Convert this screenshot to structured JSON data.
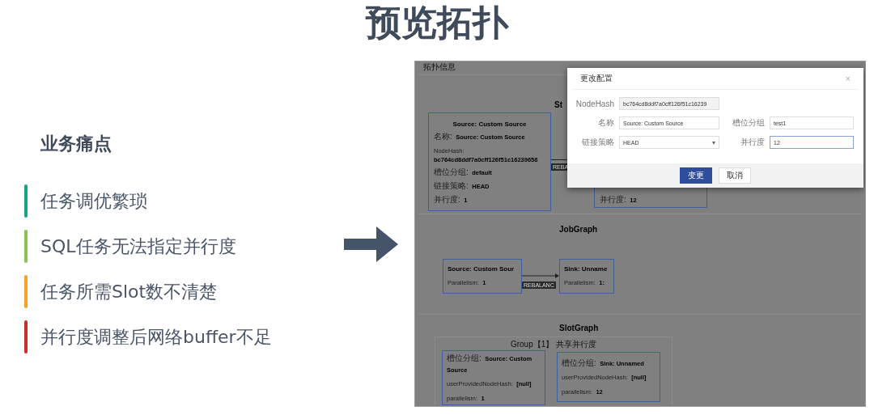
{
  "title": "预览拓扑",
  "pain_points": {
    "heading": "业务痛点",
    "items": [
      {
        "text": "任务调优繁琐",
        "color": "#1aa386"
      },
      {
        "text": "SQL任务无法指定并行度",
        "color": "#8bc157"
      },
      {
        "text": "任务所需Slot数不清楚",
        "color": "#f5a12a"
      },
      {
        "text": "并行度调整后网络buffer不足",
        "color": "#c9302c"
      }
    ]
  },
  "screenshot": {
    "header": "拓扑信息",
    "stream_graph": {
      "title": "St",
      "edge_label": "REBA",
      "source_node": {
        "title": "Source: Custom Source",
        "fields": [
          {
            "label": "名称:",
            "value": "Source: Custom Source",
            "kind": "inline"
          },
          {
            "label": "NodeHash:",
            "value": "bc764cd8ddf7a0cff126f51c16239658",
            "kind": "stacked"
          },
          {
            "label": "槽位分组:",
            "value": "default",
            "kind": "inline"
          },
          {
            "label": "链接策略:",
            "value": "HEAD",
            "kind": "inline"
          },
          {
            "label": "并行度:",
            "value": "1",
            "kind": "inline"
          }
        ]
      },
      "sink_node": {
        "fields": [
          {
            "label": "并行度:",
            "value": "12",
            "kind": "inline"
          }
        ]
      }
    },
    "job_graph": {
      "title": "JobGraph",
      "edge_label": "REBALANC",
      "nodes": [
        {
          "name": "Source: Custom Sour",
          "fields": [
            {
              "label": "Parallelism:",
              "value": "1",
              "kind": "inline"
            }
          ]
        },
        {
          "name": "Sink: Unname",
          "fields": [
            {
              "label": "Parallelism:",
              "value": "1:",
              "kind": "inline"
            }
          ]
        }
      ]
    },
    "slot_graph": {
      "title": "SlotGraph",
      "group": "Group【1】 共享并行度",
      "nodes": [
        {
          "fields": [
            {
              "label": "槽位分组:",
              "value": "Source: Custom Source",
              "kind": "inline"
            },
            {
              "label": "userProvidedNodeHash:",
              "value": "[null]",
              "kind": "inline"
            },
            {
              "label": "parallelism:",
              "value": "1",
              "kind": "inline"
            }
          ]
        },
        {
          "fields": [
            {
              "label": "槽位分组:",
              "value": "Sink: Unnamed",
              "kind": "inline"
            },
            {
              "label": "userProvidedNodeHash:",
              "value": "[null]",
              "kind": "inline"
            },
            {
              "label": "parallelism:",
              "value": "12",
              "kind": "inline"
            }
          ]
        }
      ]
    },
    "dialog": {
      "title": "更改配置",
      "close": "×",
      "fields": [
        {
          "label": "NodeHash",
          "value": "bc764cd8ddf7a0cff126f51c16239",
          "kind": "readonly",
          "focused": false
        },
        {
          "label": "名称",
          "value": "Source: Custom Source",
          "kind": "text",
          "focused": false
        },
        {
          "label": "槽位分组",
          "value": "test1",
          "kind": "text",
          "focused": false
        },
        {
          "label": "链接策略",
          "value": "HEAD",
          "kind": "select",
          "focused": false,
          "caret": "▾"
        },
        {
          "label": "并行度",
          "value": "12",
          "kind": "text",
          "focused": true
        }
      ],
      "buttons": [
        {
          "label": "变更",
          "kind": "primary"
        },
        {
          "label": "取消",
          "kind": "default"
        }
      ]
    }
  }
}
